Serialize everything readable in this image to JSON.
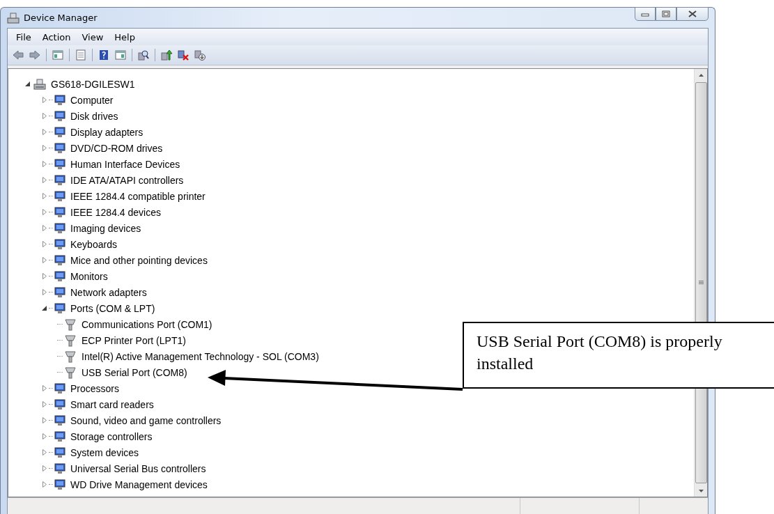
{
  "window": {
    "title": "Device Manager"
  },
  "menu": [
    "File",
    "Action",
    "View",
    "Help"
  ],
  "tree": {
    "label": "GS618-DGILESW1",
    "expanded": true,
    "children": [
      {
        "label": "Computer",
        "expanded": false
      },
      {
        "label": "Disk drives",
        "expanded": false
      },
      {
        "label": "Display adapters",
        "expanded": false
      },
      {
        "label": "DVD/CD-ROM drives",
        "expanded": false
      },
      {
        "label": "Human Interface Devices",
        "expanded": false
      },
      {
        "label": "IDE ATA/ATAPI controllers",
        "expanded": false
      },
      {
        "label": "IEEE 1284.4 compatible printer",
        "expanded": false
      },
      {
        "label": "IEEE 1284.4 devices",
        "expanded": false
      },
      {
        "label": "Imaging devices",
        "expanded": false
      },
      {
        "label": "Keyboards",
        "expanded": false
      },
      {
        "label": "Mice and other pointing devices",
        "expanded": false
      },
      {
        "label": "Monitors",
        "expanded": false
      },
      {
        "label": "Network adapters",
        "expanded": false
      },
      {
        "label": "Ports (COM & LPT)",
        "expanded": true,
        "children": [
          {
            "label": "Communications Port (COM1)"
          },
          {
            "label": "ECP Printer Port (LPT1)"
          },
          {
            "label": "Intel(R) Active Management Technology - SOL (COM3)"
          },
          {
            "label": "USB Serial Port (COM8)"
          }
        ]
      },
      {
        "label": "Processors",
        "expanded": false
      },
      {
        "label": "Smart card readers",
        "expanded": false
      },
      {
        "label": "Sound, video and game controllers",
        "expanded": false
      },
      {
        "label": "Storage controllers",
        "expanded": false
      },
      {
        "label": "System devices",
        "expanded": false
      },
      {
        "label": "Universal Serial Bus controllers",
        "expanded": false
      },
      {
        "label": "WD Drive Management devices",
        "expanded": false
      }
    ]
  },
  "callout": {
    "text": "USB Serial Port (COM8) is properly installed"
  }
}
